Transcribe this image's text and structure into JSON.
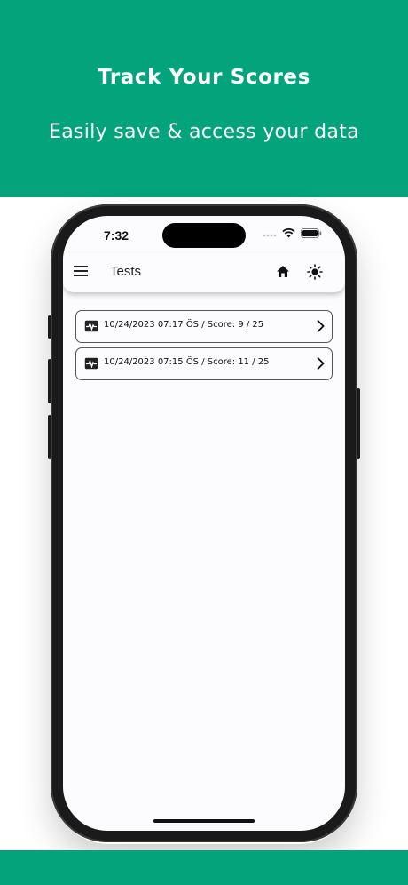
{
  "promo": {
    "title": "Track Your Scores",
    "subtitle": "Easily save & access your data"
  },
  "status_bar": {
    "time": "7:32"
  },
  "appbar": {
    "title": "Tests"
  },
  "tests": [
    {
      "date": "10/24/2023 07:17 ÖS",
      "separator": " / ",
      "score": "Score: 9 / 25"
    },
    {
      "date": "10/24/2023 07:15 ÖS",
      "separator": " / ",
      "score": "Score: 11 / 25"
    }
  ],
  "colors": {
    "brand": "#03a37c",
    "screen_bg": "#fcfbfd"
  },
  "icons": [
    "menu-icon",
    "home-icon",
    "sun-icon",
    "activity-icon",
    "chevron-right-icon",
    "wifi-icon",
    "battery-icon",
    "signal-icon"
  ]
}
